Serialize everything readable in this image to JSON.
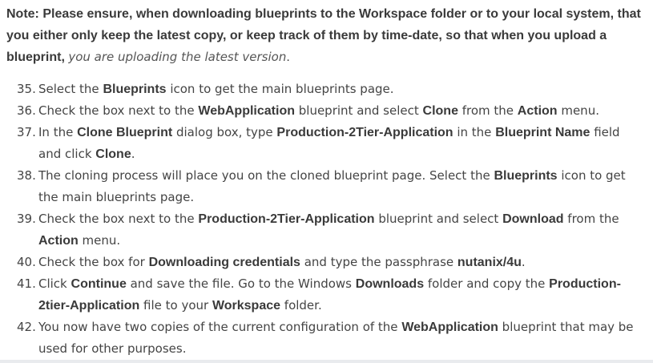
{
  "note": {
    "bold_text": "Note: Please ensure, when downloading blueprints to the Workspace folder or to your local system, that you either only keep the latest copy, or keep track of them by time-date, so that when you upload a blueprint,",
    "italic_text": "you are uploading the latest version",
    "end": "."
  },
  "steps": [
    {
      "num": "35.",
      "parts": [
        {
          "t": "Select the "
        },
        {
          "t": "Blueprints",
          "b": true
        },
        {
          "t": " icon to get the main blueprints page."
        }
      ]
    },
    {
      "num": "36.",
      "parts": [
        {
          "t": "Check the box next to the "
        },
        {
          "t": "WebApplication",
          "b": true
        },
        {
          "t": " blueprint and select "
        },
        {
          "t": "Clone",
          "b": true
        },
        {
          "t": " from the "
        },
        {
          "t": "Action",
          "b": true
        },
        {
          "t": " menu."
        }
      ]
    },
    {
      "num": "37.",
      "parts": [
        {
          "t": "In the "
        },
        {
          "t": "Clone Blueprint",
          "b": true
        },
        {
          "t": " dialog box, type "
        },
        {
          "t": "Production-2Tier-Application",
          "b": true
        },
        {
          "t": " in the "
        },
        {
          "t": "Blueprint Name",
          "b": true
        },
        {
          "t": " field and click "
        },
        {
          "t": "Clone",
          "b": true
        },
        {
          "t": "."
        }
      ]
    },
    {
      "num": "38.",
      "parts": [
        {
          "t": "The cloning process will place you on the cloned blueprint page. Select the "
        },
        {
          "t": "Blueprints",
          "b": true
        },
        {
          "t": " icon to get the main blueprints page."
        }
      ]
    },
    {
      "num": "39.",
      "parts": [
        {
          "t": "Check the box next to the "
        },
        {
          "t": "Production-2Tier-Application",
          "b": true
        },
        {
          "t": " blueprint and select "
        },
        {
          "t": "Download",
          "b": true
        },
        {
          "t": " from the "
        },
        {
          "t": "Action",
          "b": true
        },
        {
          "t": " menu."
        }
      ]
    },
    {
      "num": "40.",
      "parts": [
        {
          "t": "Check the box for "
        },
        {
          "t": "Downloading credentials",
          "b": true
        },
        {
          "t": " and type the passphrase "
        },
        {
          "t": "nutanix/4u",
          "b": true
        },
        {
          "t": "."
        }
      ]
    },
    {
      "num": "41.",
      "parts": [
        {
          "t": "Click "
        },
        {
          "t": "Continue",
          "b": true
        },
        {
          "t": " and save the file. Go to the Windows "
        },
        {
          "t": "Downloads",
          "b": true
        },
        {
          "t": " folder and copy the "
        },
        {
          "t": "Production-2tier-Application",
          "b": true
        },
        {
          "t": " file to your "
        },
        {
          "t": "Workspace",
          "b": true
        },
        {
          "t": " folder."
        }
      ]
    },
    {
      "num": "42.",
      "parts": [
        {
          "t": "You now have two copies of the current configuration of the "
        },
        {
          "t": "WebApplication",
          "b": true
        },
        {
          "t": " blueprint that may be used for other purposes."
        }
      ]
    }
  ]
}
